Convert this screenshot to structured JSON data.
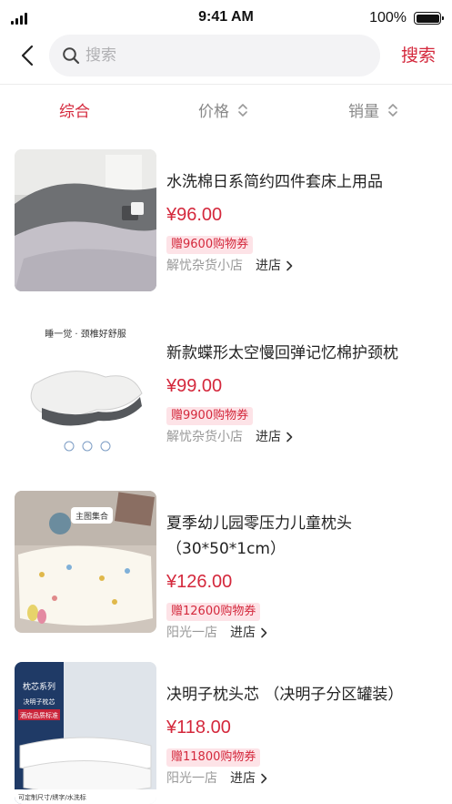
{
  "status_bar": {
    "time": "9:41 AM",
    "battery": "100%"
  },
  "search": {
    "placeholder": "搜索",
    "button_label": "搜索"
  },
  "sort_tabs": [
    {
      "label": "综合",
      "active": true
    },
    {
      "label": "价格",
      "active": false
    },
    {
      "label": "销量",
      "active": false
    }
  ],
  "products": [
    {
      "title": "水洗棉日系简约四件套床上用品",
      "price": "¥96.00",
      "coupon": "赠9600购物券",
      "shop": "解忧杂货小店",
      "enter_label": "进店"
    },
    {
      "title": "新款蝶形太空慢回弹记忆棉护颈枕",
      "price": "¥99.00",
      "coupon": "赠9900购物券",
      "shop": "解忧杂货小店",
      "enter_label": "进店",
      "image_text": "睡一觉 · 颈椎好舒服"
    },
    {
      "title": "夏季幼儿园零压力儿童枕头（30*50*1cm）",
      "price": "¥126.00",
      "coupon": "赠12600购物券",
      "shop": "阳光一店",
      "enter_label": "进店",
      "image_text": "主图集合"
    },
    {
      "title": "决明子枕头芯 （决明子分区罐装）",
      "price": "¥118.00",
      "coupon": "赠11800购物券",
      "shop": "阳光一店",
      "enter_label": "进店",
      "image_text": [
        "枕芯系列",
        "决明子枕芯",
        "酒店品质标准",
        "可定制尺寸/绣字/水洗标"
      ]
    }
  ],
  "colors": {
    "accent": "#d4283c",
    "coupon_bg": "#fde3e7",
    "muted": "#999999"
  }
}
